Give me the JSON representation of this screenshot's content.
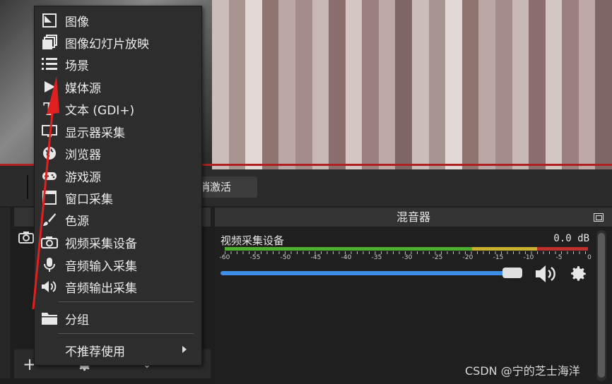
{
  "preview": {
    "deactivate_button": "消激活"
  },
  "context_menu": {
    "items": [
      {
        "label": "图像",
        "icon": "image-icon"
      },
      {
        "label": "图像幻灯片放映",
        "icon": "slideshow-icon"
      },
      {
        "label": "场景",
        "icon": "scene-list-icon"
      },
      {
        "label": "媒体源",
        "icon": "play-icon"
      },
      {
        "label": "文本 (GDI+)",
        "icon": "text-icon"
      },
      {
        "label": "显示器采集",
        "icon": "monitor-icon"
      },
      {
        "label": "浏览器",
        "icon": "globe-icon"
      },
      {
        "label": "游戏源",
        "icon": "gamepad-icon"
      },
      {
        "label": "窗口采集",
        "icon": "window-icon"
      },
      {
        "label": "色源",
        "icon": "brush-icon"
      },
      {
        "label": "视频采集设备",
        "icon": "camera-icon"
      },
      {
        "label": "音频输入采集",
        "icon": "microphone-icon"
      },
      {
        "label": "音频输出采集",
        "icon": "speaker-icon"
      }
    ],
    "group_item": {
      "label": "分组",
      "icon": "folder-icon"
    },
    "deprecated_item": {
      "label": "不推荐使用"
    }
  },
  "sources_panel": {
    "add_symbol": "+",
    "remove_symbol": "—"
  },
  "mixer": {
    "title": "混音器",
    "track_name": "视频采集设备",
    "level_db": "0.0 dB",
    "volume_level": 0.97,
    "scale_labels": [
      "-60",
      "-55",
      "-50",
      "-45",
      "-40",
      "-35",
      "-30",
      "-25",
      "-20",
      "-15",
      "-10",
      "-5",
      "0"
    ]
  },
  "watermark": "CSDN @宁的芝士海洋",
  "colors": {
    "accent_blue": "#3d8ee6",
    "meter_green": "#4caf30",
    "meter_yellow": "#c8b030",
    "meter_red": "#c0302c",
    "annotation_red": "#e02020"
  }
}
